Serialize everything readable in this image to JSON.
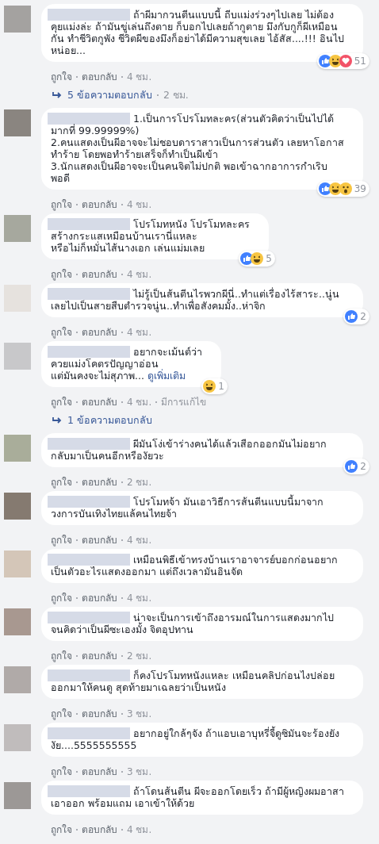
{
  "comments": [
    {
      "kind": "comment",
      "color": "#a4a2a0",
      "text": "ถ้าผีมากวนตีนแบบนี้ ถีบแม่งร่วงๆไปเลย ไม่ต้องคุยแม่งล่ะ ถ้ามันขู่เล่นถึงตาย ก็บอกไปเลยถ้ากูตาย มึงกับกูก็ผีเหมือนกัน ทำชีวิตกูพัง ชีวิตผีของมึงก็อย่าได้มีความสุขเลย ไอ้สัส....!!! อินไปหน่อย...",
      "reactions": [
        {
          "kind": "like"
        },
        {
          "kind": "haha"
        },
        {
          "kind": "love"
        }
      ],
      "reaction_count": "51",
      "actions": [
        "ถูกใจ",
        "ตอบกลับ"
      ],
      "time": "4 ชม."
    },
    {
      "kind": "replies",
      "label": "5 ข้อความตอบกลับ",
      "time": "2 ชม."
    },
    {
      "kind": "comment",
      "color": "#8a8580",
      "text": "1.เป็นการโปรโมทละคร(ส่วนตัวคิดว่าเป็นไปได้มากที่ 99.99999%)\n2.คนแสดงเป็นผีอาจจะไม่ชอบดาราสาวเป็นการส่วนตัว เลยหาโอกาสทำร้าย โดยพอทำร้ายเสร็จก็ทำเป็นผีเข้า\n3.นักแสดงเป็นผีอาจจะเป็นคนจิตไม่ปกติ พอเข้าฉากอาการกำเริบพอดี",
      "reactions": [
        {
          "kind": "like"
        },
        {
          "kind": "haha"
        },
        {
          "kind": "wow"
        }
      ],
      "reaction_count": "39",
      "actions": [
        "ถูกใจ",
        "ตอบกลับ"
      ],
      "time": "4 ชม."
    },
    {
      "kind": "comment",
      "color": "#a6a89e",
      "text": "โปรโมทหนัง โปรโมทละคร\nสร้างกระแสเหมือนบ้านเรานี่แหละ\nหรือไม่ก็หมั่นไส้นางเอก เล่นแม่มเลย",
      "reactions": [
        {
          "kind": "like"
        },
        {
          "kind": "haha"
        }
      ],
      "reaction_count": "5",
      "actions": [
        "ถูกใจ",
        "ตอบกลับ"
      ],
      "time": "4 ชม."
    },
    {
      "kind": "comment",
      "color": "#e6e2de",
      "text": "ไม่รู้เป็นส้นตีนไรพวกผีนี่..ทำแต่เรื่องไร้สาระ..นู่นเลยไปเป็นสายสืบตำรวจนู่น..ทำเพื่อสังคมมั้ง..ห่าจิก",
      "reactions": [
        {
          "kind": "like"
        }
      ],
      "reaction_count": "2",
      "actions": [
        "ถูกใจ",
        "ตอบกลับ"
      ],
      "time": "4 ชม."
    },
    {
      "kind": "comment",
      "color": "#c8c8ca",
      "text": "อยากจะเม้นต์ว่า\nควยแม่งโคตรปัญญาอ่อน\nแต่มันคงจะไม่สุภาพ...",
      "see_more": "ดูเพิ่มเติม",
      "reactions": [
        {
          "kind": "haha"
        }
      ],
      "reaction_count": "1",
      "actions": [
        "ถูกใจ",
        "ตอบกลับ"
      ],
      "time": "4 ชม.",
      "edited": "มีการแก้ไข"
    },
    {
      "kind": "replies",
      "label": "1 ข้อความตอบกลับ"
    },
    {
      "kind": "comment",
      "color": "#a9ad9a",
      "text": "ผีมันโง่เข้าร่างคนได้แล้วเสือกออกมันไม่อยากกลับมาเป็นคนอีกหรืองัยวะ",
      "reactions": [
        {
          "kind": "like"
        }
      ],
      "reaction_count": "2",
      "actions": [
        "ถูกใจ",
        "ตอบกลับ"
      ],
      "time": "2 ชม."
    },
    {
      "kind": "comment",
      "color": "#857a70",
      "text": "โปรโมทจ้า มันเอาวิธีการส้นตีนแบบนี้มาจากวงการบันเทิงไทยแล้คนไทยจ้า",
      "actions": [
        "ถูกใจ",
        "ตอบกลับ"
      ],
      "time": "4 ชม."
    },
    {
      "kind": "comment",
      "color": "#d4c6b8",
      "text": "เหมือนพิธีเข้าทรงบ้านเราอาจารย์บอกก่อนอยากเป็นตัวอะไรแสดงออกมา แต่ถึงเวลามันอินจัด",
      "actions": [
        "ถูกใจ",
        "ตอบกลับ"
      ],
      "time": "4 ชม."
    },
    {
      "kind": "comment",
      "color": "#a89890",
      "text": "น่าจะเป็นการเข้าถึงอารมณ์ในการแสดงมากไปจนคิดว่าเป็นผีซะเองมั้ง จิตอุปทาน",
      "actions": [
        "ถูกใจ",
        "ตอบกลับ"
      ],
      "time": "2 ชม."
    },
    {
      "kind": "comment",
      "color": "#b0aaa8",
      "text": "ก็คงโปรโมทหนังแหละ เหมือนคลิปก่อนไงปล่อยออกมาให้คนดู สุดท้ายมาเฉลยว่าเป็นหนัง",
      "actions": [
        "ถูกใจ",
        "ตอบกลับ"
      ],
      "time": "3 ชม."
    },
    {
      "kind": "comment",
      "color": "#c0bcbc",
      "text": "อยากอยู่ใกล้ๆจัง ถ้าแอบเอาบุหรี่จี้ดูซิมันจะร้องยังงัย....5555555555",
      "actions": [
        "ถูกใจ",
        "ตอบกลับ"
      ],
      "time": "3 ชม."
    },
    {
      "kind": "comment",
      "color": "#9c9896",
      "text": "ถ้าโดนส้นตีน ผีจะออกโดยเร็ว ถ้ามีผู้หญิงผมอาสา เอาออก พร้อมแถม เอาเข้าให้ด้วย",
      "actions": [
        "ถูกใจ",
        "ตอบกลับ"
      ],
      "time": "4 ชม."
    }
  ]
}
